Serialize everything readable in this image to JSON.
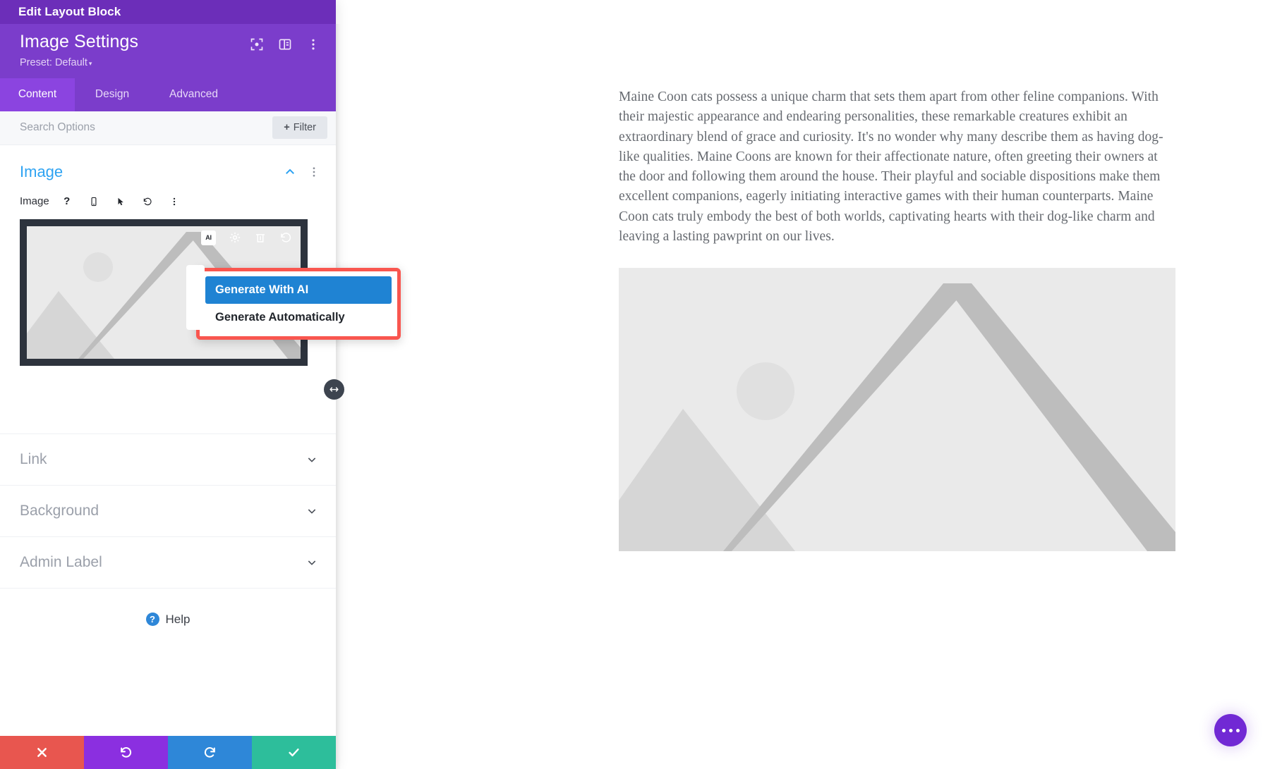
{
  "window": {
    "edit_bar_title": "Edit Layout Block"
  },
  "panel": {
    "title": "Image Settings",
    "preset_label": "Preset: Default",
    "preset_caret": "▾",
    "header_icons": [
      {
        "name": "focus-target-icon"
      },
      {
        "name": "panel-layout-icon"
      },
      {
        "name": "more-vertical-icon"
      }
    ],
    "tabs": [
      {
        "label": "Content",
        "active": true
      },
      {
        "label": "Design",
        "active": false
      },
      {
        "label": "Advanced",
        "active": false
      }
    ],
    "search": {
      "value": "",
      "placeholder": "Search Options"
    },
    "filter_button": {
      "plus": "+",
      "label": "Filter"
    },
    "image_section": {
      "title": "Image",
      "field_label": "Image",
      "field_icons": [
        {
          "name": "help-question-icon",
          "glyph": "?"
        },
        {
          "name": "mobile-device-icon"
        },
        {
          "name": "cursor-pointer-icon"
        },
        {
          "name": "reset-undo-icon"
        },
        {
          "name": "more-vertical-icon"
        }
      ],
      "preview_tools": [
        {
          "name": "ai-badge-icon",
          "label": "AI"
        },
        {
          "name": "gear-settings-icon"
        },
        {
          "name": "trash-delete-icon"
        },
        {
          "name": "undo-reset-icon"
        }
      ]
    },
    "ai_menu": {
      "items": [
        {
          "label": "Generate With AI",
          "selected": true
        },
        {
          "label": "Generate Automatically",
          "selected": false
        }
      ],
      "highlight_color": "#F9564F",
      "selected_color": "#1F83D3"
    },
    "collapsible_sections": [
      {
        "label": "Link"
      },
      {
        "label": "Background"
      },
      {
        "label": "Admin Label"
      }
    ],
    "help": {
      "badge": "?",
      "label": "Help"
    },
    "footer_buttons": [
      {
        "name": "cancel-button",
        "icon": "close-x-icon",
        "color": "#E8564F"
      },
      {
        "name": "undo-button",
        "icon": "undo-icon",
        "color": "#8B2FE0"
      },
      {
        "name": "redo-button",
        "icon": "redo-icon",
        "color": "#2E87D8"
      },
      {
        "name": "save-button",
        "icon": "check-icon",
        "color": "#2DBE9B"
      }
    ]
  },
  "canvas": {
    "paragraph": "Maine Coon cats possess a unique charm that sets them apart from other feline companions. With their majestic appearance and endearing personalities, these remarkable creatures exhibit an extraordinary blend of grace and curiosity. It's no wonder why many describe them as having dog-like qualities. Maine Coons are known for their affectionate nature, often greeting their owners at the door and following them around the house. Their playful and sociable dispositions make them excellent companions, eagerly initiating interactive games with their human counterparts. Maine Coon cats truly embody the best of both worlds, captivating hearts with their dog-like charm and leaving a lasting pawprint on our lives.",
    "image_placeholder_name": "image-placeholder-mountains",
    "fab": {
      "name": "more-options-fab",
      "icon": "three-dots-icon"
    }
  },
  "colors": {
    "brand_purple": "#7B3DCB",
    "edit_bar_purple": "#6C2EB9",
    "accent_blue": "#2EA3F2",
    "highlight_red": "#F9564F"
  }
}
